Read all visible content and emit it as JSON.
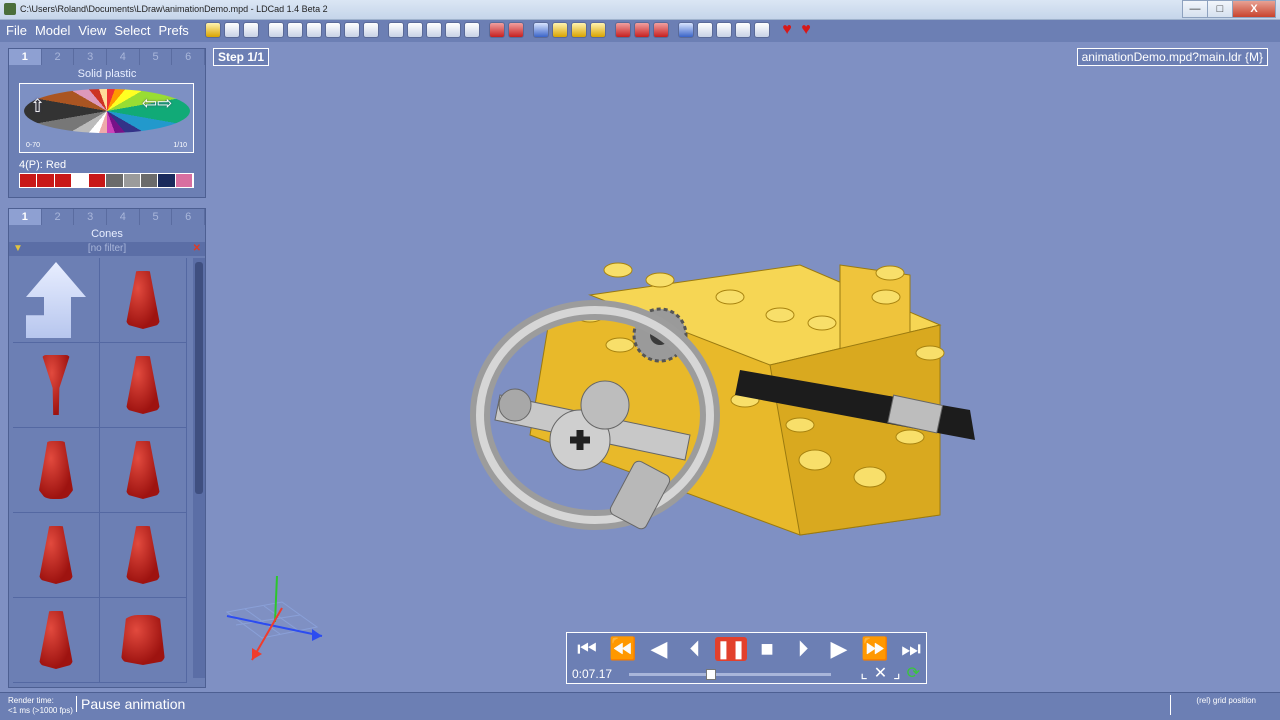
{
  "window": {
    "title": "C:\\Users\\Roland\\Documents\\LDraw\\animationDemo.mpd - LDCad 1.4 Beta 2",
    "min": "—",
    "max": "□",
    "close": "X"
  },
  "menu": [
    "File",
    "Model",
    "View",
    "Select",
    "Prefs"
  ],
  "color_panel": {
    "tabs": [
      "1",
      "2",
      "3",
      "4",
      "5",
      "6"
    ],
    "title": "Solid plastic",
    "range_lo": "0-70",
    "range_hi": "1/10",
    "selected": "4(P): Red",
    "swatches": [
      "#c81818",
      "#c81818",
      "#c81818",
      "#ffffff",
      "#c81818",
      "#6b6b6b",
      "#9b9b9b",
      "#6b6b6b",
      "#1a2a5c",
      "#d86fa0"
    ]
  },
  "parts_panel": {
    "tabs": [
      "1",
      "2",
      "3",
      "4",
      "5",
      "6"
    ],
    "title": "Cones",
    "filter": "[no filter]"
  },
  "view": {
    "step": "Step 1/1",
    "model_name": "animationDemo.mpd?main.ldr {M}"
  },
  "animation": {
    "time": "0:07.17",
    "progress": 0.38
  },
  "status": {
    "render_time_label": "Render time:",
    "render_time_value": "<1 ms (>1000 fps)",
    "message": "Pause animation",
    "grid": "(rel) grid position"
  },
  "colors": {
    "background": "#7f90c3",
    "panel": "#6c7fb4",
    "brick": "#f1c232",
    "pause_active": "#e2402c"
  }
}
